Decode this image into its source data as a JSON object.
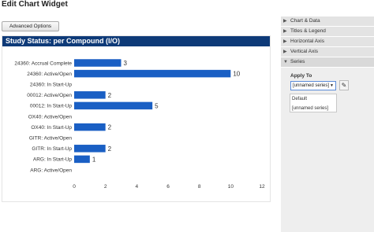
{
  "header": {
    "title": "Edit Chart Widget"
  },
  "toolbar": {
    "advanced_label": "Advanced Options"
  },
  "chart_panel": {
    "title": "Study Status: per Compound (I/O)"
  },
  "chart_data": {
    "type": "bar",
    "orientation": "horizontal",
    "title": "Study Status: per Compound (I/O)",
    "categories": [
      "24360: Accrual Complete",
      "24360: Active/Open",
      "24360: In Start-Up",
      "00012: Active/Open",
      "00012: In Start-Up",
      "OX40: Active/Open",
      "OX40: In Start-Up",
      "GITR: Active/Open",
      "GITR: In Start-Up",
      "ARG: In Start-Up",
      "ARG: Active/Open"
    ],
    "values": [
      3,
      10,
      0,
      2,
      5,
      0,
      2,
      0,
      2,
      1,
      0
    ],
    "value_labels": [
      "3",
      "10",
      "",
      "2",
      "5",
      "",
      "2",
      "",
      "2",
      "1",
      ""
    ],
    "xlim": [
      0,
      12
    ],
    "xticks": [
      "0",
      "2",
      "4",
      "6",
      "8",
      "10",
      "12"
    ],
    "bar_color": "#1a5fc4",
    "grid": false
  },
  "side_panel": {
    "sections": [
      {
        "label": "Chart & Data",
        "expanded": false,
        "arrow": "▶"
      },
      {
        "label": "Titles & Legend",
        "expanded": false,
        "arrow": "▶"
      },
      {
        "label": "Horizontal Axis",
        "expanded": false,
        "arrow": "▶"
      },
      {
        "label": "Vertical Axis",
        "expanded": false,
        "arrow": "▶"
      },
      {
        "label": "Series",
        "expanded": true,
        "arrow": "▼"
      }
    ],
    "series": {
      "apply_to_label": "Apply To",
      "selected": "[unnamed series]",
      "options": [
        "Default",
        "[unnamed series]"
      ]
    }
  },
  "colors": {
    "header_bg": "#0e3a78",
    "bar": "#1a5fc4",
    "select_border": "#5b8bd8"
  }
}
